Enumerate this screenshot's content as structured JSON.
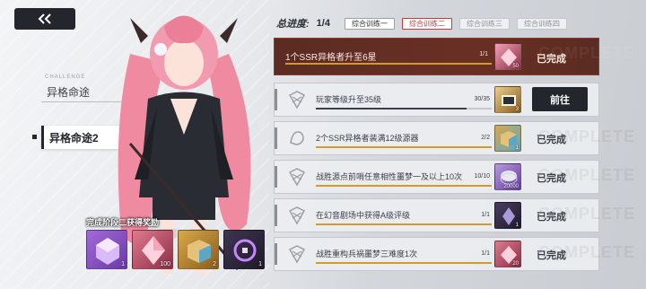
{
  "nav": {
    "back_icon": "double-chevron-left-icon"
  },
  "sidebar": {
    "caption": "CHALLENGE",
    "items": [
      {
        "label": "异格命途",
        "active": false
      },
      {
        "label": "异格命途2",
        "active": true
      }
    ]
  },
  "progress": {
    "label": "总进度:",
    "value": "1/4",
    "tabs": [
      "综合训练一",
      "综合训练二",
      "综合训练三",
      "综合训练四"
    ],
    "active_tab": 1
  },
  "tasks": [
    {
      "desc": "1个SSR异格者升至6星",
      "progress": "1/1",
      "fraction": 1.0,
      "item_count": "50",
      "item_color": "#c0506a",
      "status": "已完成",
      "highlight": true
    },
    {
      "desc": "玩家等级升至35级",
      "progress": "30/35",
      "fraction": 0.857,
      "item_count": "3",
      "item_color": "#d8a94a",
      "status": "前往",
      "action": true
    },
    {
      "desc": "2个SSR异格者装满12级源器",
      "progress": "2/2",
      "fraction": 1.0,
      "item_count": "1",
      "item_color": "#5aa7c8",
      "status": "已完成"
    },
    {
      "desc": "战胜源点前哨任意相性噩梦一及以上10次",
      "progress": "10/10",
      "fraction": 1.0,
      "item_count": "20000",
      "item_color": "#8a5fc2",
      "status": "已完成"
    },
    {
      "desc": "在幻音剧场中获得A级评级",
      "progress": "1/1",
      "fraction": 1.0,
      "item_count": "1",
      "item_color": "#3e3550",
      "status": "已完成"
    },
    {
      "desc": "战胜重构兵祸噩梦三难度1次",
      "progress": "1/1",
      "fraction": 1.0,
      "item_count": "20",
      "item_color": "#c0506a",
      "status": "已完成"
    }
  ],
  "rewards": {
    "title": "完成阶段二获得奖励",
    "items": [
      {
        "count": "1",
        "color": "#a26bd6"
      },
      {
        "count": "100",
        "color": "#c0506a"
      },
      {
        "count": "2",
        "color": "#d8a94a"
      },
      {
        "count": "1",
        "color": "#3e3550"
      }
    ]
  }
}
